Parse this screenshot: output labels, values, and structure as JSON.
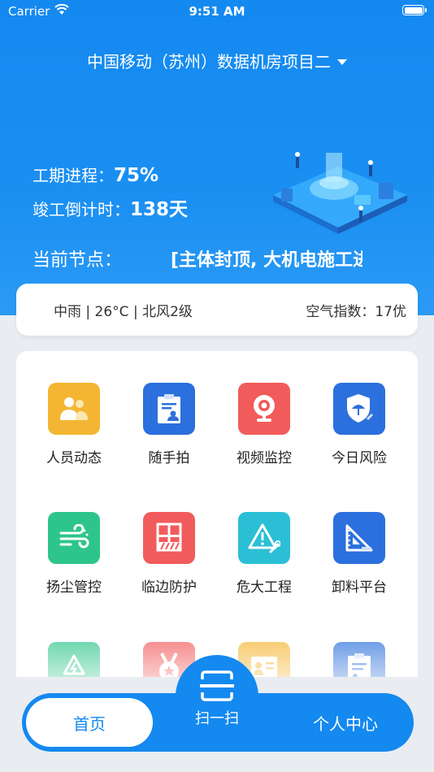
{
  "status_bar": {
    "carrier": "Carrier",
    "time": "9:51 AM",
    "battery_level": 1.0
  },
  "header": {
    "project_title": "中国移动（苏州）数据机房项目二",
    "progress_label": "工期进程：",
    "progress_value": "75%",
    "countdown_label": "竣工倒计时：",
    "countdown_value": "138天",
    "node_label": "当前节点：",
    "node_value": "[主体封顶, 大机电施工进场]"
  },
  "weather": {
    "summary": "中雨 | 26°C | 北风2级",
    "air_quality": "空气指数：17优"
  },
  "menu": {
    "items": [
      {
        "label": "人员动态",
        "icon": "people-icon",
        "color": "#f4b632"
      },
      {
        "label": "随手拍",
        "icon": "clipboard-person-icon",
        "color": "#2b70dc"
      },
      {
        "label": "视频监控",
        "icon": "webcam-icon",
        "color": "#f25b5b"
      },
      {
        "label": "今日风险",
        "icon": "shield-umbrella-icon",
        "color": "#2b70dc"
      },
      {
        "label": "扬尘管控",
        "icon": "wind-icon",
        "color": "#2ec58a"
      },
      {
        "label": "临边防护",
        "icon": "guardrail-icon",
        "color": "#f25b5b"
      },
      {
        "label": "危大工程",
        "icon": "warning-wrench-icon",
        "color": "#2bbfd6"
      },
      {
        "label": "卸料平台",
        "icon": "set-square-icon",
        "color": "#2b70dc"
      },
      {
        "label": "",
        "icon": "recycle-icon",
        "color": "#2ec58a"
      },
      {
        "label": "",
        "icon": "medal-icon",
        "color": "#f25b5b"
      },
      {
        "label": "",
        "icon": "certificate-icon",
        "color": "#f4b632"
      },
      {
        "label": "",
        "icon": "checklist-icon",
        "color": "#2b70dc"
      }
    ]
  },
  "tabbar": {
    "home": "首页",
    "scan": "扫一扫",
    "profile": "个人中心"
  },
  "colors": {
    "primary": "#1489f0",
    "background": "#e9ecf1"
  }
}
